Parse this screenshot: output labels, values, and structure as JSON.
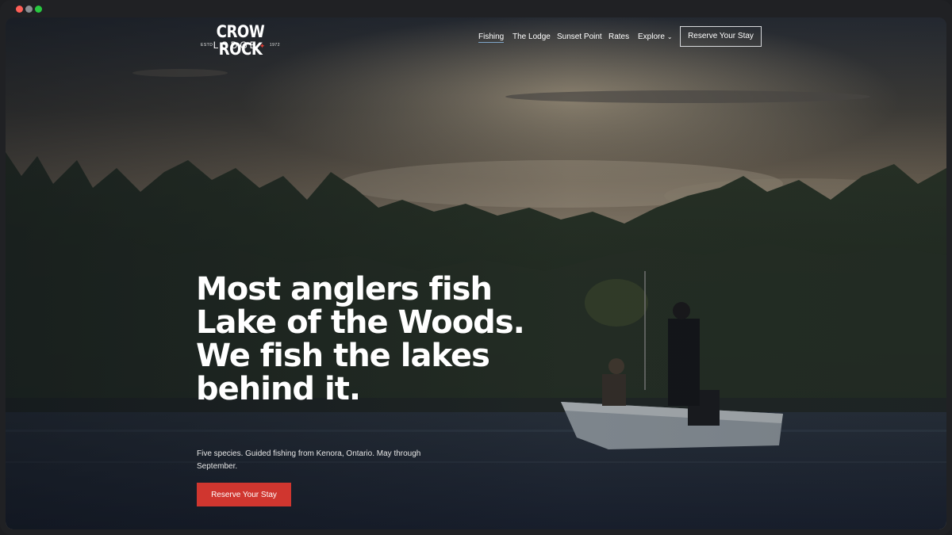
{
  "window": {
    "controls": [
      "close",
      "minimize",
      "maximize"
    ]
  },
  "header": {
    "logo": {
      "line1": "CROW ROCK",
      "line2": "LODGE",
      "est_label": "ESTD",
      "year": "1972",
      "emblem": "maple-leaf-icon"
    },
    "nav": {
      "items": [
        {
          "label": "Fishing",
          "active": true
        },
        {
          "label": "The Lodge",
          "active": false
        },
        {
          "label": "Sunset Point",
          "active": false
        },
        {
          "label": "Rates",
          "active": false
        },
        {
          "label": "Explore",
          "active": false,
          "has_dropdown": true
        }
      ],
      "cta_label": "Reserve Your Stay"
    }
  },
  "hero": {
    "headline": "Most anglers fish Lake of the Woods. We fish the lakes behind it.",
    "subhead": "Five species. Guided fishing from Kenora, Ontario. May through September.",
    "cta_label": "Reserve Your Stay",
    "background": "lake-sunset-fishing-boat-photo"
  },
  "colors": {
    "accent": "#d0362f",
    "nav_underline": "#7fa6c9",
    "text": "#ffffff"
  }
}
